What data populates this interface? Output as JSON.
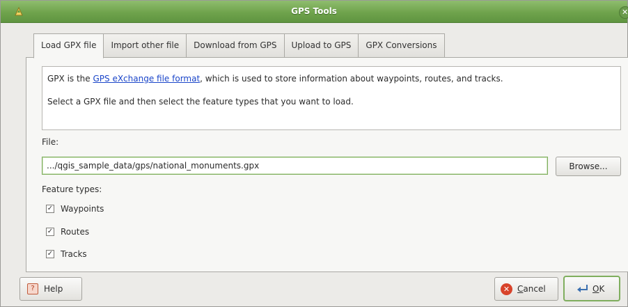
{
  "window": {
    "title": "GPS Tools",
    "close_glyph": "✕"
  },
  "tabs": [
    {
      "label": "Load GPX file",
      "active": true
    },
    {
      "label": "Import other file",
      "active": false
    },
    {
      "label": "Download from GPS",
      "active": false
    },
    {
      "label": "Upload to GPS",
      "active": false
    },
    {
      "label": "GPX Conversions",
      "active": false
    }
  ],
  "info": {
    "line1_prefix": "GPX is the ",
    "line1_link": "GPS eXchange file format",
    "line1_suffix": ", which is used to store information about waypoints, routes, and tracks.",
    "line2": "Select a GPX file and then select the feature types that you want to load."
  },
  "file": {
    "label": "File:",
    "value": ".../qgis_sample_data/gps/national_monuments.gpx",
    "browse_label": "Browse..."
  },
  "feature_types": {
    "label": "Feature types:",
    "items": [
      {
        "label": "Waypoints",
        "checked": true
      },
      {
        "label": "Routes",
        "checked": true
      },
      {
        "label": "Tracks",
        "checked": true
      }
    ]
  },
  "buttons": {
    "help": "Help",
    "cancel_mnemonic": "C",
    "cancel_rest": "ancel",
    "ok_mnemonic": "O",
    "ok_rest": "K"
  },
  "colors": {
    "titlebar": "#6fa34c",
    "link": "#1a45c9",
    "focus": "#7fae5e",
    "cancel_icon": "#d8432a"
  },
  "icons": {
    "app": "qgis-icon",
    "close": "close-icon",
    "help": "help-icon",
    "cancel": "cancel-icon",
    "ok": "ok-icon",
    "check": "checkmark-icon"
  }
}
